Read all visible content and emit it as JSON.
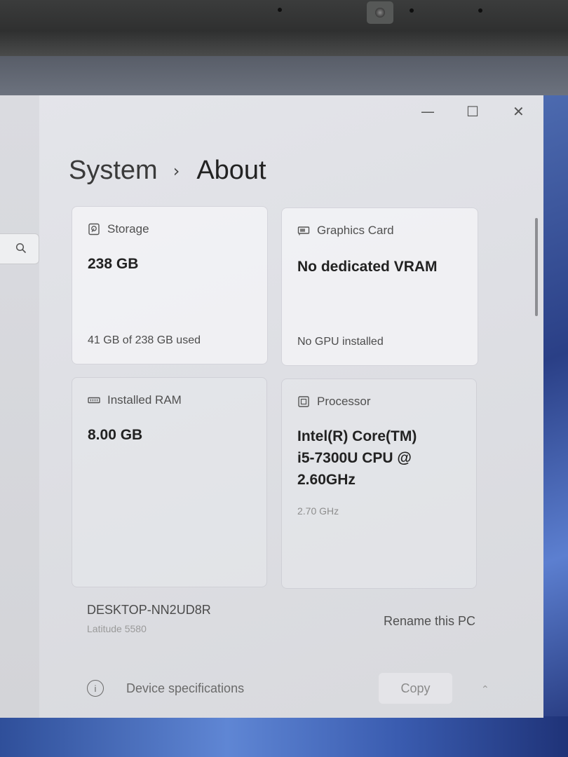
{
  "window": {
    "minimize_glyph": "—",
    "maximize_glyph": "☐",
    "close_glyph": "✕"
  },
  "breadcrumb": {
    "parent": "System",
    "separator": "›",
    "current": "About"
  },
  "cards": {
    "storage": {
      "title": "Storage",
      "icon": "storage-drive-icon",
      "value": "238 GB",
      "sub": "41 GB of 238 GB used"
    },
    "graphics": {
      "title": "Graphics Card",
      "icon": "graphics-card-icon",
      "value": "No dedicated VRAM",
      "sub": "No GPU installed"
    },
    "ram": {
      "title": "Installed RAM",
      "icon": "memory-icon",
      "value": "8.00 GB"
    },
    "processor": {
      "title": "Processor",
      "icon": "processor-chip-icon",
      "value_line1": "Intel(R) Core(TM)",
      "value_line2": "i5-7300U CPU @",
      "value_line3": "2.60GHz",
      "sub": "2.70 GHz"
    }
  },
  "device": {
    "name": "DESKTOP-NN2UD8R",
    "model": "Latitude 5580",
    "rename_label": "Rename this PC"
  },
  "specs": {
    "label": "Device specifications",
    "copy_label": "Copy",
    "chevron": "⌃"
  },
  "colors": {
    "window_bg": "#e2e3e8",
    "card_bg": "#f3f3f5",
    "text_primary": "#222222",
    "wallpaper_accent": "#4d6bb0"
  }
}
